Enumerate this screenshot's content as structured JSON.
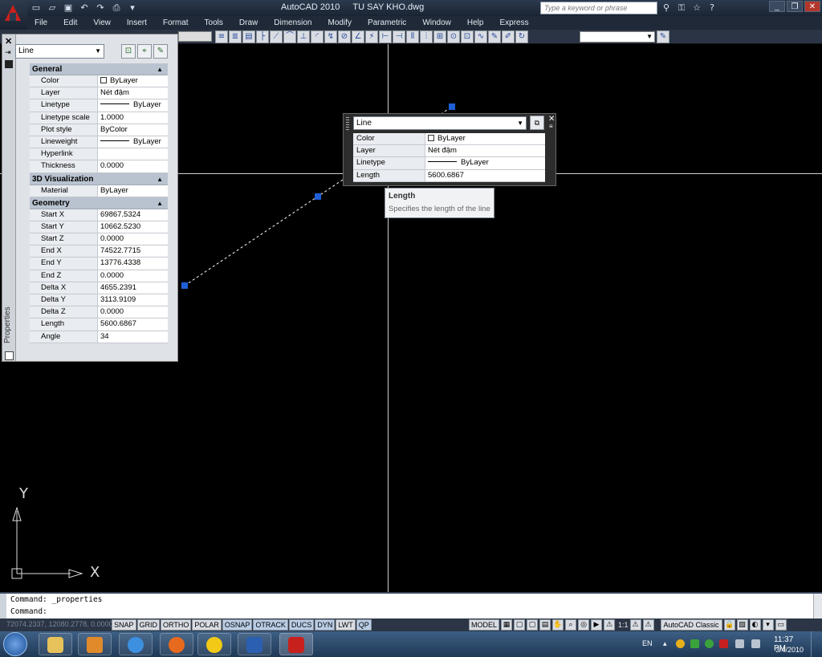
{
  "app": {
    "title": "AutoCAD 2010",
    "file": "TU SAY KHO.dwg",
    "search_placeholder": "Type a keyword or phrase"
  },
  "menus": [
    "File",
    "Edit",
    "View",
    "Insert",
    "Format",
    "Tools",
    "Draw",
    "Dimension",
    "Modify",
    "Parametric",
    "Window",
    "Help",
    "Express"
  ],
  "properties": {
    "palette_label": "Properties",
    "selected": "Line",
    "categories": [
      {
        "name": "General",
        "rows": [
          {
            "label": "Color",
            "value": "ByLayer",
            "kind": "color"
          },
          {
            "label": "Layer",
            "value": "Nét đậm"
          },
          {
            "label": "Linetype",
            "value": "ByLayer",
            "kind": "linetype"
          },
          {
            "label": "Linetype scale",
            "value": "1.0000"
          },
          {
            "label": "Plot style",
            "value": "ByColor"
          },
          {
            "label": "Lineweight",
            "value": "ByLayer",
            "kind": "linetype"
          },
          {
            "label": "Hyperlink",
            "value": ""
          },
          {
            "label": "Thickness",
            "value": "0.0000"
          }
        ]
      },
      {
        "name": "3D Visualization",
        "rows": [
          {
            "label": "Material",
            "value": "ByLayer"
          }
        ]
      },
      {
        "name": "Geometry",
        "rows": [
          {
            "label": "Start X",
            "value": "69867.5324"
          },
          {
            "label": "Start Y",
            "value": "10662.5230"
          },
          {
            "label": "Start Z",
            "value": "0.0000"
          },
          {
            "label": "End X",
            "value": "74522.7715"
          },
          {
            "label": "End Y",
            "value": "13776.4338"
          },
          {
            "label": "End Z",
            "value": "0.0000"
          },
          {
            "label": "Delta X",
            "value": "4655.2391"
          },
          {
            "label": "Delta Y",
            "value": "3113.9109"
          },
          {
            "label": "Delta Z",
            "value": "0.0000"
          },
          {
            "label": "Length",
            "value": "5600.6867"
          },
          {
            "label": "Angle",
            "value": "34"
          }
        ]
      }
    ]
  },
  "quick_properties": {
    "selected": "Line",
    "rows": [
      {
        "label": "Color",
        "value": "ByLayer",
        "kind": "color"
      },
      {
        "label": "Layer",
        "value": "Nét đậm"
      },
      {
        "label": "Linetype",
        "value": "ByLayer",
        "kind": "linetype"
      },
      {
        "label": "Length",
        "value": "5600.6867"
      }
    ]
  },
  "tooltip": {
    "title": "Length",
    "description": "Specifies the length of the line"
  },
  "ucs": {
    "x_label": "X",
    "y_label": "Y"
  },
  "command_line": {
    "history": "Command:  _properties",
    "prompt": "Command:"
  },
  "status": {
    "coords": "72074.2337, 12080.2778, 0.0000",
    "toggles": [
      {
        "label": "SNAP",
        "on": false
      },
      {
        "label": "GRID",
        "on": false
      },
      {
        "label": "ORTHO",
        "on": false
      },
      {
        "label": "POLAR",
        "on": false
      },
      {
        "label": "OSNAP",
        "on": true
      },
      {
        "label": "OTRACK",
        "on": true
      },
      {
        "label": "DUCS",
        "on": true
      },
      {
        "label": "DYN",
        "on": true
      },
      {
        "label": "LWT",
        "on": false
      },
      {
        "label": "QP",
        "on": true
      }
    ],
    "model": "MODEL",
    "annotation_scale": "1:1",
    "workspace": "AutoCAD Classic"
  },
  "taskbar": {
    "language": "EN",
    "time": "11:37 PM",
    "date": "3/4/2010"
  },
  "colors": {
    "canvas": "#000000",
    "grip": "#1e5fd6",
    "crosshair": "#cfcfcf"
  }
}
